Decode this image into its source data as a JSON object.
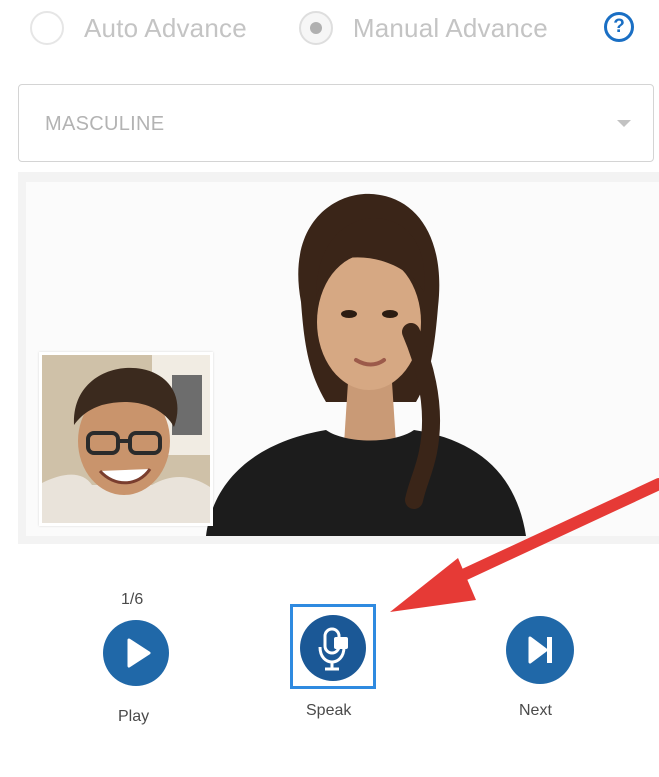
{
  "advance_mode": {
    "auto_label": "Auto Advance",
    "manual_label": "Manual Advance",
    "selected": "manual",
    "help_icon": "question-circle-icon",
    "help_glyph": "?"
  },
  "voice_select": {
    "value": "MASCULINE",
    "caret_icon": "chevron-down-icon"
  },
  "player": {
    "counter": "1/6",
    "play_label": "Play",
    "speak_label": "Speak",
    "next_label": "Next",
    "play_icon": "play-icon",
    "speak_icon": "microphone-icon",
    "next_icon": "skip-next-icon"
  },
  "colors": {
    "accent_blue": "#2068a8",
    "highlight_blue": "#2f8ae0",
    "callout_red": "#e63a36",
    "muted_text": "#c4c4c4"
  }
}
